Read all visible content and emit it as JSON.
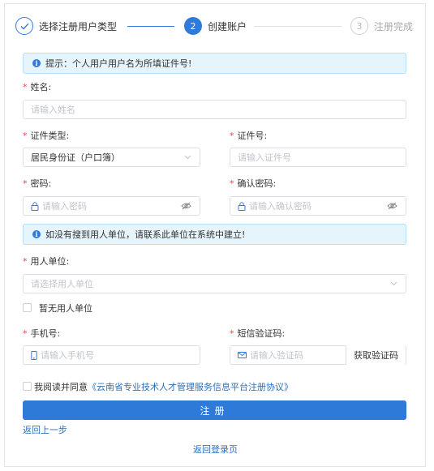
{
  "steps": [
    {
      "number": "✓",
      "label": "选择注册用户类型",
      "state": "done"
    },
    {
      "number": "2",
      "label": "创建账户",
      "state": "active"
    },
    {
      "number": "3",
      "label": "注册完成",
      "state": "todo"
    }
  ],
  "notices": {
    "tip": "提示：个人用户用户名为所填证件号!",
    "employer_tip": "如没有搜到用人单位，请联系此单位在系统中建立!"
  },
  "form": {
    "name": {
      "label": "姓名:",
      "placeholder": "请输入姓名"
    },
    "id_type": {
      "label": "证件类型:",
      "value": "居民身份证（户口簿）"
    },
    "id_number": {
      "label": "证件号:",
      "placeholder": "请输入证件号"
    },
    "password": {
      "label": "密码:",
      "placeholder": "请输入密码"
    },
    "confirm_password": {
      "label": "确认密码:",
      "placeholder": "请输入确认密码"
    },
    "employer": {
      "label": "用人单位:",
      "placeholder": "请选择用人单位"
    },
    "no_employer": {
      "label": "暂无用人单位"
    },
    "phone": {
      "label": "手机号:",
      "placeholder": "请输入手机号"
    },
    "sms_code": {
      "label": "短信验证码:",
      "placeholder": "请输入验证码",
      "button": "获取验证码"
    },
    "agreement": {
      "prefix": "我阅读并同意",
      "link": "《云南省专业技术人才管理服务信息平台注册协议》"
    }
  },
  "actions": {
    "submit": "注册",
    "back": "返回上一步",
    "login": "返回登录页"
  },
  "colors": {
    "primary": "#2e7ad8",
    "required": "#e5484d",
    "notice_bg": "#e6f4fc"
  }
}
